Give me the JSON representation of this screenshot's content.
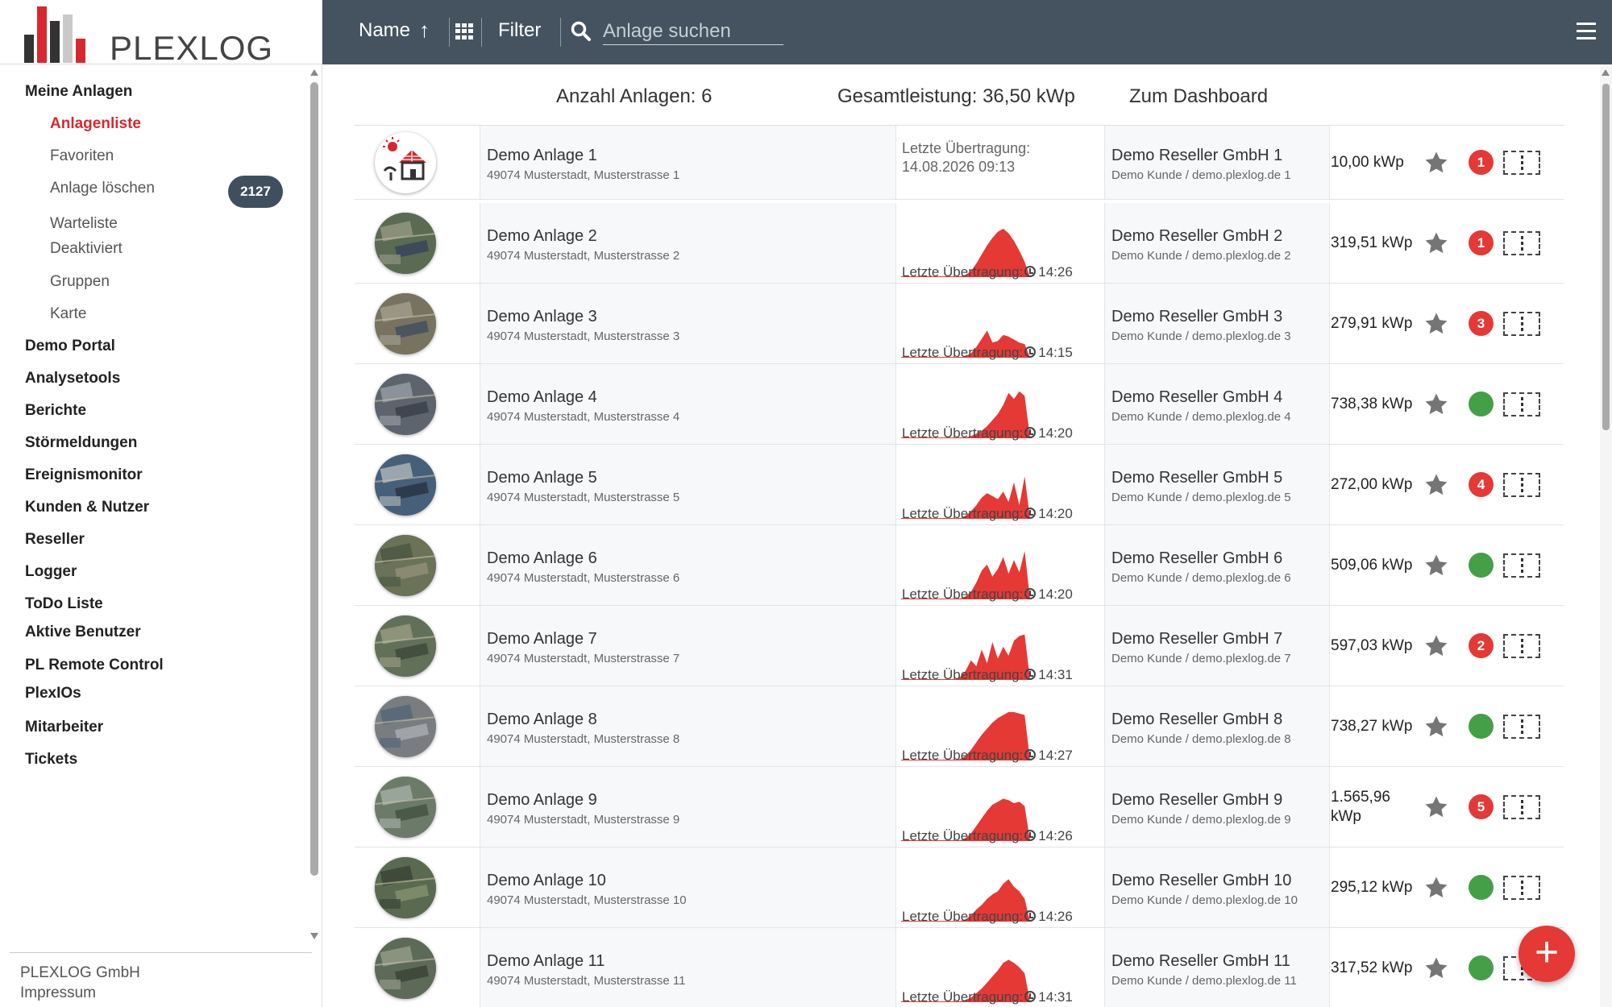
{
  "brand": {
    "name": "PLEXLOG",
    "colors": {
      "accent": "#d7282f",
      "header": "#44535f",
      "bar_dark": "#333333",
      "bar_light": "#bdbdbd"
    }
  },
  "header": {
    "sort_label": "Name",
    "sort_arrow": "↑",
    "filter_label": "Filter",
    "search_placeholder": "Anlage suchen",
    "grid_icon": "grid-icon",
    "menu_icon": "hamburger-icon"
  },
  "sidebar": {
    "sections": [
      {
        "label": "Meine Anlagen",
        "type": "header"
      },
      {
        "label": "Anlagenliste",
        "type": "sub",
        "active": true
      },
      {
        "label": "Favoriten",
        "type": "sub"
      },
      {
        "label": "Anlage löschen",
        "type": "sub"
      },
      {
        "label": "Warteliste",
        "type": "sub",
        "badge": "2127"
      },
      {
        "label": "Deaktiviert",
        "type": "sub"
      },
      {
        "label": "Gruppen",
        "type": "sub"
      },
      {
        "label": "Karte",
        "type": "sub"
      },
      {
        "label": "Demo Portal",
        "type": "header"
      },
      {
        "label": "Analysetools",
        "type": "header"
      },
      {
        "label": "Berichte",
        "type": "header"
      },
      {
        "label": "Störmeldungen",
        "type": "header"
      },
      {
        "label": "Ereignismonitor",
        "type": "header"
      },
      {
        "label": "Kunden & Nutzer",
        "type": "header"
      },
      {
        "label": "Reseller",
        "type": "header"
      },
      {
        "label": "Logger",
        "type": "header"
      },
      {
        "label": "ToDo Liste",
        "type": "header"
      },
      {
        "label": "Aktive Benutzer",
        "type": "header"
      },
      {
        "label": "PL Remote Control",
        "type": "header"
      },
      {
        "label": "PlexIOs",
        "type": "header"
      },
      {
        "label": "Mitarbeiter",
        "type": "header"
      },
      {
        "label": "Tickets",
        "type": "header"
      }
    ],
    "footer": {
      "company": "PLEXLOG GmbH",
      "impressum": "Impressum"
    }
  },
  "summary": {
    "count": "Anzahl Anlagen: 6",
    "total": "Gesamtleistung: 36,50 kWp",
    "dashboard": "Zum Dashboard"
  },
  "last_tx_label": "Letzte Übertragung:",
  "plants": [
    {
      "name": "Demo Anlage 1",
      "address": "49074 Musterstadt, Musterstrasse 1",
      "thumb": "house-solar-icon",
      "last_tx": "Letzte Übertragung:",
      "last_tx_date": "14.08.2026 09:13",
      "reseller": "Demo Reseller GmbH 1",
      "sub": "Demo Kunde / demo.plexlog.de 1",
      "kwp": "10,00 kWp",
      "status": "1",
      "status_color": "red",
      "chart": []
    },
    {
      "name": "Demo Anlage 2",
      "address": "49074 Musterstadt, Musterstrasse 2",
      "thumb": "aerial",
      "time": "14:26",
      "reseller": "Demo Reseller GmbH 2",
      "sub": "Demo Kunde / demo.plexlog.de 2",
      "kwp": "319,51 kWp",
      "status": "1",
      "status_color": "red",
      "chart": [
        0,
        0,
        0,
        0,
        0,
        0,
        0,
        0,
        0,
        0,
        0,
        1,
        3,
        8,
        18,
        30,
        42,
        52,
        60,
        64,
        58,
        48,
        35,
        20,
        0
      ]
    },
    {
      "name": "Demo Anlage 3",
      "address": "49074 Musterstadt, Musterstrasse 3",
      "thumb": "aerial",
      "time": "14:15",
      "reseller": "Demo Reseller GmbH 3",
      "sub": "Demo Kunde / demo.plexlog.de 3",
      "kwp": "279,91 kWp",
      "status": "3",
      "status_color": "red",
      "chart": [
        0,
        0,
        0,
        0,
        0,
        0,
        0,
        0,
        0,
        0,
        0,
        0,
        2,
        6,
        14,
        25,
        36,
        20,
        22,
        30,
        28,
        24,
        20,
        18,
        0
      ]
    },
    {
      "name": "Demo Anlage 4",
      "address": "49074 Musterstadt, Musterstrasse 4",
      "thumb": "aerial",
      "time": "14:20",
      "reseller": "Demo Reseller GmbH 4",
      "sub": "Demo Kunde / demo.plexlog.de 4",
      "kwp": "738,38 kWp",
      "status": "",
      "status_color": "green",
      "chart": [
        0,
        0,
        0,
        0,
        0,
        0,
        0,
        0,
        0,
        0,
        0,
        0,
        1,
        3,
        6,
        10,
        16,
        24,
        32,
        44,
        60,
        52,
        62,
        56,
        0
      ]
    },
    {
      "name": "Demo Anlage 5",
      "address": "49074 Musterstadt, Musterstrasse 5",
      "thumb": "aerial",
      "time": "14:20",
      "reseller": "Demo Reseller GmbH 5",
      "sub": "Demo Kunde / demo.plexlog.de 5",
      "kwp": "272,00 kWp",
      "status": "4",
      "status_color": "red",
      "chart": [
        0,
        0,
        0,
        0,
        0,
        0,
        0,
        0,
        0,
        0,
        0,
        1,
        4,
        10,
        18,
        28,
        34,
        30,
        26,
        36,
        22,
        48,
        18,
        56,
        0
      ]
    },
    {
      "name": "Demo Anlage 6",
      "address": "49074 Musterstadt, Musterstrasse 6",
      "thumb": "aerial",
      "time": "14:20",
      "reseller": "Demo Reseller GmbH 6",
      "sub": "Demo Kunde / demo.plexlog.de 6",
      "kwp": "509,06 kWp",
      "status": "",
      "status_color": "green",
      "chart": [
        0,
        0,
        0,
        0,
        0,
        0,
        0,
        0,
        0,
        0,
        0,
        1,
        4,
        10,
        22,
        38,
        46,
        30,
        40,
        56,
        34,
        52,
        36,
        64,
        0
      ]
    },
    {
      "name": "Demo Anlage 7",
      "address": "49074 Musterstadt, Musterstrasse 7",
      "thumb": "aerial",
      "time": "14:31",
      "reseller": "Demo Reseller GmbH 7",
      "sub": "Demo Kunde / demo.plexlog.de 7",
      "kwp": "597,03 kWp",
      "status": "2",
      "status_color": "red",
      "chart": [
        0,
        0,
        0,
        0,
        0,
        0,
        0,
        0,
        0,
        0,
        1,
        4,
        12,
        26,
        18,
        40,
        22,
        50,
        28,
        44,
        32,
        52,
        58,
        60,
        0
      ]
    },
    {
      "name": "Demo Anlage 8",
      "address": "49074 Musterstadt, Musterstrasse 8",
      "thumb": "aerial",
      "time": "14:27",
      "reseller": "Demo Reseller GmbH 8",
      "sub": "Demo Kunde / demo.plexlog.de 8",
      "kwp": "738,27 kWp",
      "status": "",
      "status_color": "green",
      "chart": [
        0,
        0,
        0,
        0,
        0,
        0,
        0,
        0,
        0,
        0,
        0,
        2,
        6,
        14,
        24,
        34,
        42,
        50,
        56,
        60,
        64,
        64,
        62,
        60,
        0
      ]
    },
    {
      "name": "Demo Anlage 9",
      "address": "49074 Musterstadt, Musterstrasse 9",
      "thumb": "aerial",
      "time": "14:26",
      "reseller": "Demo Reseller GmbH 9",
      "sub": "Demo Kunde / demo.plexlog.de 9",
      "kwp": "1.565,96 kWp",
      "status": "5",
      "status_color": "red",
      "chart": [
        0,
        0,
        0,
        0,
        0,
        0,
        0,
        0,
        0,
        0,
        0,
        1,
        4,
        10,
        20,
        30,
        40,
        48,
        52,
        56,
        54,
        50,
        52,
        46,
        0
      ]
    },
    {
      "name": "Demo Anlage 10",
      "address": "49074 Musterstadt, Musterstrasse 10",
      "thumb": "aerial",
      "time": "14:26",
      "reseller": "Demo Reseller GmbH 10",
      "sub": "Demo Kunde / demo.plexlog.de 10",
      "kwp": "295,12 kWp",
      "status": "",
      "status_color": "green",
      "chart": [
        0,
        0,
        0,
        0,
        0,
        0,
        0,
        0,
        0,
        0,
        0,
        1,
        3,
        8,
        16,
        22,
        30,
        36,
        40,
        50,
        56,
        46,
        40,
        30,
        0
      ]
    },
    {
      "name": "Demo Anlage 11",
      "address": "49074 Musterstadt, Musterstrasse 11",
      "thumb": "aerial",
      "time": "14:31",
      "reseller": "Demo Reseller GmbH 11",
      "sub": "Demo Kunde / demo.plexlog.de 11",
      "kwp": "317,52 kWp",
      "status": "",
      "status_color": "green",
      "chart": [
        0,
        0,
        0,
        0,
        0,
        0,
        0,
        0,
        0,
        0,
        0,
        1,
        3,
        6,
        12,
        18,
        26,
        34,
        42,
        52,
        56,
        52,
        46,
        38,
        0
      ]
    }
  ],
  "fab": {
    "label": "+"
  }
}
